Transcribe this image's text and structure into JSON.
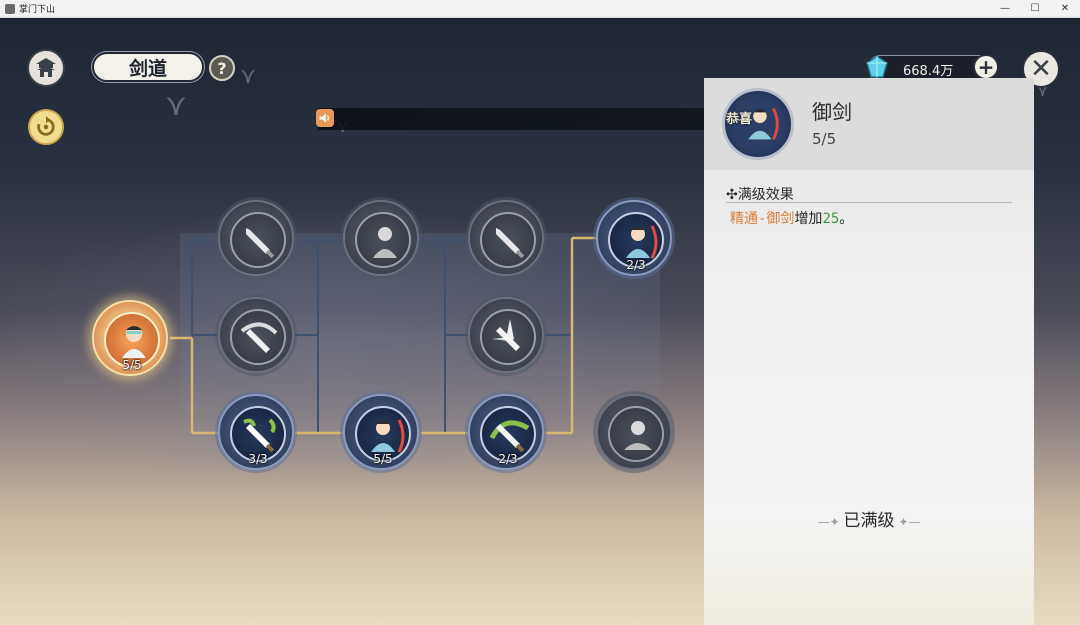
{
  "window": {
    "title": "掌门下山",
    "minimize": "—",
    "maximize": "☐",
    "close": "✕"
  },
  "header": {
    "title": "剑道",
    "help_label": "?",
    "currency_amount": "668.4万",
    "currency_plus": "+",
    "close_label": "✕"
  },
  "tree": {
    "root_level": "5/5",
    "nodes": [
      {
        "id": "top-1",
        "state": "locked",
        "level": ""
      },
      {
        "id": "top-2",
        "state": "locked",
        "level": ""
      },
      {
        "id": "top-3",
        "state": "locked",
        "level": ""
      },
      {
        "id": "top-4",
        "state": "active",
        "level": "2/3"
      },
      {
        "id": "mid-1",
        "state": "locked",
        "level": ""
      },
      {
        "id": "mid-3",
        "state": "locked",
        "level": ""
      },
      {
        "id": "bot-1",
        "state": "active",
        "level": "3/3"
      },
      {
        "id": "bot-2",
        "state": "active",
        "level": "5/5"
      },
      {
        "id": "bot-3",
        "state": "active",
        "level": "2/3"
      },
      {
        "id": "bot-4",
        "state": "locked",
        "level": ""
      }
    ]
  },
  "panel": {
    "skill_tag": "恭喜",
    "skill_name": "御剑",
    "skill_level": "5/5",
    "section_title": "满级效果",
    "effect_part1": "精通-御剑",
    "effect_part2": "增加",
    "effect_part3": "25",
    "effect_part4": "。",
    "maxed_label": "已满级",
    "maxed_deco": "—✦"
  },
  "colors": {
    "accent_orange": "#e07a36",
    "accent_green": "#3f9a3f",
    "line_gold": "#d8b770"
  }
}
